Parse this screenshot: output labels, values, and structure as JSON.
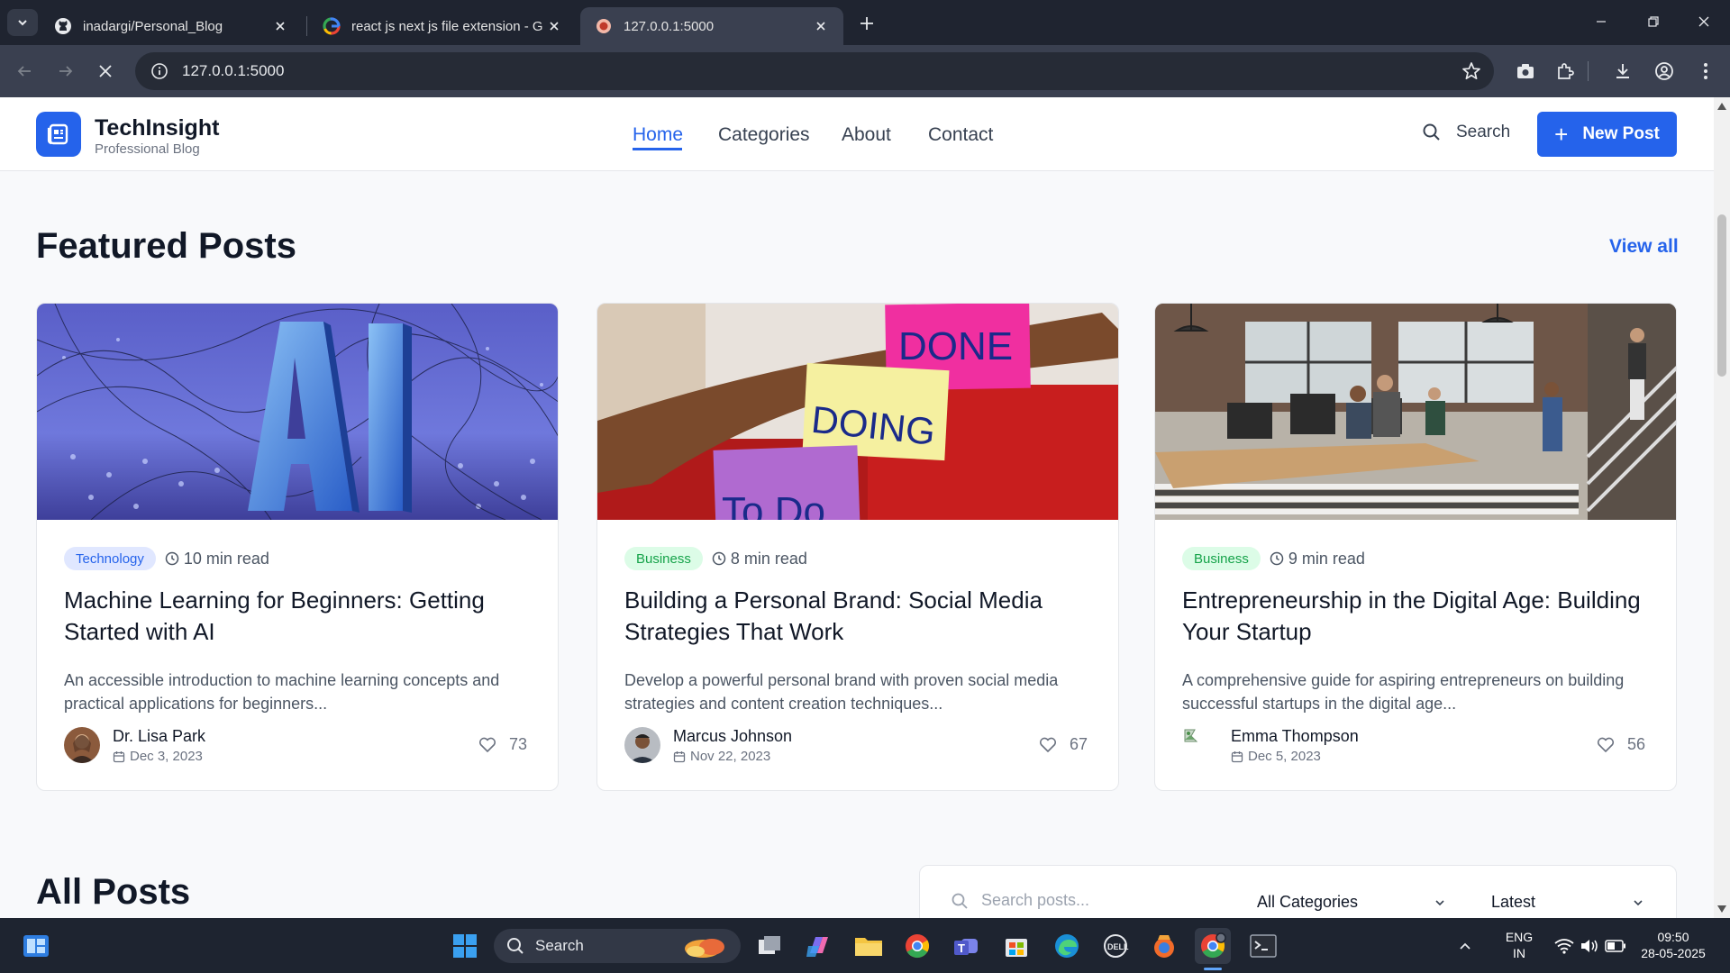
{
  "browser": {
    "tabs": [
      {
        "title": "inadargi/Personal_Blog",
        "active": false
      },
      {
        "title": "react js next js file extension - G",
        "active": false
      },
      {
        "title": "127.0.0.1:5000",
        "active": true
      }
    ],
    "url": "127.0.0.1:5000"
  },
  "site": {
    "brand": {
      "name": "TechInsight",
      "tagline": "Professional Blog"
    },
    "nav": [
      {
        "label": "Home",
        "active": true
      },
      {
        "label": "Categories",
        "active": false
      },
      {
        "label": "About",
        "active": false
      },
      {
        "label": "Contact",
        "active": false
      }
    ],
    "search_label": "Search",
    "new_post_label": "New Post",
    "accent_color": "#2563eb"
  },
  "featured": {
    "title": "Featured Posts",
    "view_all": "View all",
    "posts": [
      {
        "category": "Technology",
        "read_time": "10 min read",
        "title": "Machine Learning for Beginners: Getting Started with AI",
        "excerpt": "An accessible introduction to machine learning concepts and practical applications for beginners...",
        "author": "Dr. Lisa Park",
        "date": "Dec 3, 2023",
        "likes": "73"
      },
      {
        "category": "Business",
        "read_time": "8 min read",
        "title": "Building a Personal Brand: Social Media Strategies That Work",
        "excerpt": "Develop a powerful personal brand with proven social media strategies and content creation techniques...",
        "author": "Marcus Johnson",
        "date": "Nov 22, 2023",
        "likes": "67"
      },
      {
        "category": "Business",
        "read_time": "9 min read",
        "title": "Entrepreneurship in the Digital Age: Building Your Startup",
        "excerpt": "A comprehensive guide for aspiring entrepreneurs on building successful startups in the digital age...",
        "author": "Emma Thompson",
        "date": "Dec 5, 2023",
        "likes": "56"
      }
    ]
  },
  "featured_images": {
    "card1": {
      "text": "AI"
    },
    "card2": {
      "notes": [
        "DONE",
        "DOING",
        "To Do"
      ]
    }
  },
  "all_posts": {
    "title": "All Posts",
    "search_placeholder": "Search posts...",
    "category_filter": "All Categories",
    "sort_filter": "Latest"
  },
  "taskbar": {
    "search_label": "Search",
    "lang": "ENG",
    "region": "IN",
    "time": "09:50",
    "date": "28-05-2025"
  }
}
